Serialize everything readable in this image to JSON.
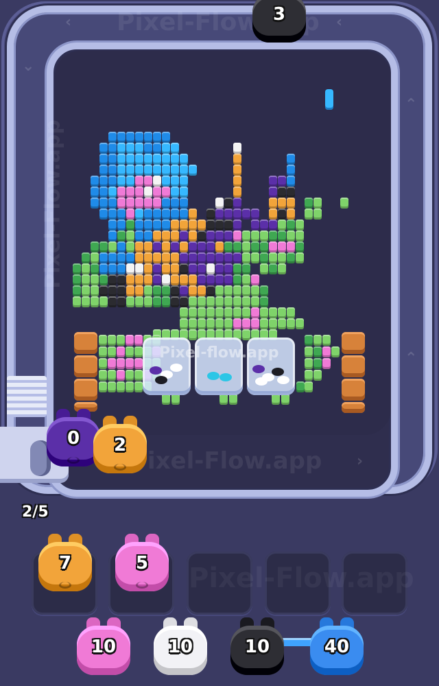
{
  "top_pig": {
    "count": "3",
    "color": "#2e2e34"
  },
  "conveyor_pigs": [
    {
      "count": "0",
      "color": "#5b2fa8"
    },
    {
      "count": "2",
      "color": "#f2a43a"
    }
  ],
  "queue_counter": "2/5",
  "holding_slots": [
    {
      "count": "7",
      "color": "#f2a43a",
      "filled": true
    },
    {
      "count": "5",
      "color": "#f07ad6",
      "filled": true
    },
    {
      "filled": false
    },
    {
      "filled": false
    },
    {
      "filled": false
    }
  ],
  "bottom_pigs": [
    {
      "count": "10",
      "color": "#f07ad6"
    },
    {
      "count": "10",
      "color": "#f2f2f6"
    },
    {
      "count": "10",
      "color": "#2e2e34"
    },
    {
      "count": "40",
      "color": "#3a8cf0"
    }
  ],
  "watermark_text": "Pixel-Flow.app",
  "glass_watermark": "Pixel-flow.app",
  "palette": {
    "cyan": "#36b8ff",
    "blue": "#1f8be8",
    "green": "#7fd36a",
    "dark_green": "#3fa852",
    "purple": "#5b2fa8",
    "orange": "#f2a43a",
    "pink": "#f07ad6",
    "white": "#f4f4f4",
    "black": "#2b2b30",
    "wood": "#d7823a"
  }
}
